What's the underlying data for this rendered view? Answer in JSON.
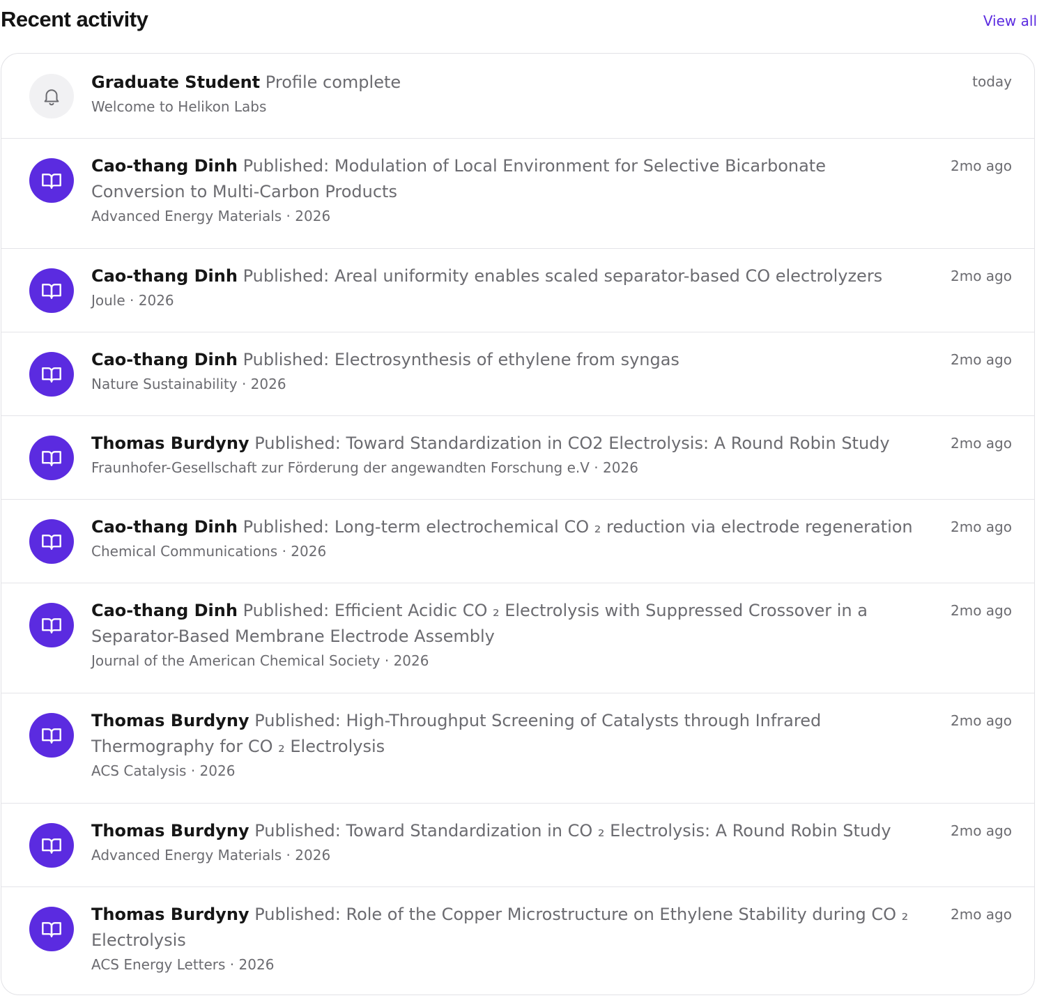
{
  "header": {
    "title": "Recent activity",
    "view_all": "View all"
  },
  "activity": [
    {
      "icon": "bell-icon",
      "actor": "Graduate Student",
      "action": "Profile complete",
      "subtitle": "Welcome to Helikon Labs",
      "time": "today"
    },
    {
      "icon": "book-icon",
      "actor": "Cao-thang Dinh",
      "action": "Published: Modulation of Local Environment for Selective Bicarbonate Conversion to Multi-Carbon Products",
      "subtitle": "Advanced Energy Materials · 2026",
      "time": "2mo ago"
    },
    {
      "icon": "book-icon",
      "actor": "Cao-thang Dinh",
      "action": "Published: Areal uniformity enables scaled separator-based CO electrolyzers",
      "subtitle": "Joule · 2026",
      "time": "2mo ago"
    },
    {
      "icon": "book-icon",
      "actor": "Cao-thang Dinh",
      "action": "Published: Electrosynthesis of ethylene from syngas",
      "subtitle": "Nature Sustainability · 2026",
      "time": "2mo ago"
    },
    {
      "icon": "book-icon",
      "actor": "Thomas Burdyny",
      "action": "Published: Toward Standardization in CO2 Electrolysis: A Round Robin Study",
      "subtitle": "Fraunhofer-Gesellschaft zur Förderung der angewandten Forschung e.V · 2026",
      "time": "2mo ago"
    },
    {
      "icon": "book-icon",
      "actor": "Cao-thang Dinh",
      "action": "Published: Long-term electrochemical CO ₂ reduction via electrode regeneration",
      "subtitle": "Chemical Communications · 2026",
      "time": "2mo ago"
    },
    {
      "icon": "book-icon",
      "actor": "Cao-thang Dinh",
      "action": "Published: Efficient Acidic CO ₂ Electrolysis with Suppressed Crossover in a Separator-Based Membrane Electrode Assembly",
      "subtitle": "Journal of the American Chemical Society · 2026",
      "time": "2mo ago"
    },
    {
      "icon": "book-icon",
      "actor": "Thomas Burdyny",
      "action": "Published: High-Throughput Screening of Catalysts through Infrared Thermography for CO ₂ Electrolysis",
      "subtitle": "ACS Catalysis · 2026",
      "time": "2mo ago"
    },
    {
      "icon": "book-icon",
      "actor": "Thomas Burdyny",
      "action": "Published: Toward Standardization in CO ₂ Electrolysis: A Round Robin Study",
      "subtitle": "Advanced Energy Materials · 2026",
      "time": "2mo ago"
    },
    {
      "icon": "book-icon",
      "actor": "Thomas Burdyny",
      "action": "Published: Role of the Copper Microstructure on Ethylene Stability during CO ₂ Electrolysis",
      "subtitle": "ACS Energy Letters · 2026",
      "time": "2mo ago"
    }
  ],
  "colors": {
    "accent": "#5b2be0",
    "bell_bg": "#f1f1f3",
    "muted_text": "#6b6b70",
    "border": "#e4e4e8"
  }
}
